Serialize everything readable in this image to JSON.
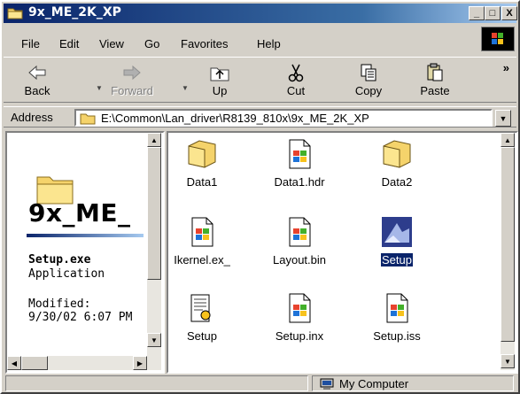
{
  "window": {
    "title": "9x_ME_2K_XP",
    "minimize": "_",
    "maximize": "□",
    "close": "X"
  },
  "menu": {
    "items": [
      "File",
      "Edit",
      "View",
      "Go",
      "Favorites",
      "Help"
    ]
  },
  "toolbar": {
    "back": "Back",
    "forward": "Forward",
    "up": "Up",
    "cut": "Cut",
    "copy": "Copy",
    "paste": "Paste",
    "more": "»"
  },
  "address": {
    "label": "Address",
    "value": "E:\\Common\\Lan_driver\\R8139_810x\\9x_ME_2K_XP"
  },
  "left_pane": {
    "folder_title": "9x_ME_",
    "selected_name": "Setup.exe",
    "selected_type": "Application",
    "modified_label": "Modified:",
    "modified_value": "9/30/02 6:07 PM"
  },
  "files": [
    {
      "name": "Data1",
      "icon": "folder-icon",
      "selected": false
    },
    {
      "name": "Data1.hdr",
      "icon": "file-windows-icon",
      "selected": false
    },
    {
      "name": "Data2",
      "icon": "folder-icon",
      "selected": false
    },
    {
      "name": "Ikernel.ex_",
      "icon": "file-windows-icon",
      "selected": false
    },
    {
      "name": "Layout.bin",
      "icon": "file-windows-icon",
      "selected": false
    },
    {
      "name": "Setup",
      "icon": "setup-app-icon",
      "selected": true
    },
    {
      "name": "Setup",
      "icon": "config-file-icon",
      "selected": false
    },
    {
      "name": "Setup.inx",
      "icon": "file-windows-icon",
      "selected": false
    },
    {
      "name": "Setup.iss",
      "icon": "file-windows-icon",
      "selected": false
    }
  ],
  "status": {
    "location": "My Computer"
  },
  "colors": {
    "titlebar_start": "#0a246a",
    "titlebar_end": "#a6caf0",
    "selection": "#0a246a",
    "face": "#d4d0c8"
  }
}
